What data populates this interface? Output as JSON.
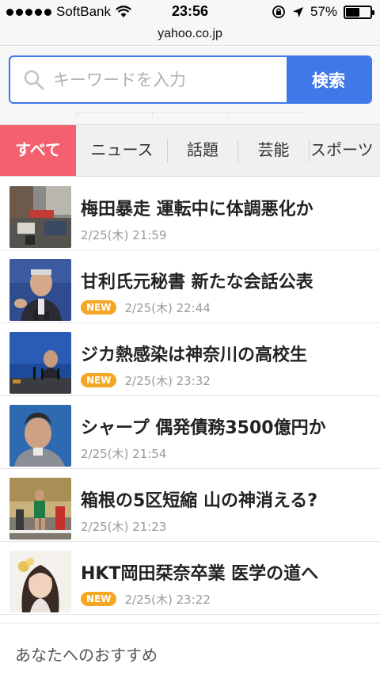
{
  "status_bar": {
    "carrier": "SoftBank",
    "time": "23:56",
    "battery": "57%",
    "battery_level": 0.57
  },
  "browser": {
    "url": "yahoo.co.jp"
  },
  "search": {
    "placeholder": "キーワードを入力",
    "button_label": "検索"
  },
  "tabs": [
    {
      "label": "すべて",
      "active": true
    },
    {
      "label": "ニュース"
    },
    {
      "label": "話題"
    },
    {
      "label": "芸能"
    },
    {
      "label": "スポーツ"
    }
  ],
  "news": [
    {
      "title": "梅田暴走 運転中に体調悪化か",
      "date": "2/25(木) 21:59",
      "is_new": false
    },
    {
      "title": "甘利氏元秘書 新たな会話公表",
      "date": "2/25(木) 22:44",
      "is_new": true
    },
    {
      "title": "ジカ熱感染は神奈川の高校生",
      "date": "2/25(木) 23:32",
      "is_new": true
    },
    {
      "title": "シャープ 偶発債務3500億円か",
      "date": "2/25(木) 21:54",
      "is_new": false
    },
    {
      "title": "箱根の5区短縮 山の神消える?",
      "date": "2/25(木) 21:23",
      "is_new": false
    },
    {
      "title": "HKT岡田栞奈卒業 医学の道へ",
      "date": "2/25(木) 23:22",
      "is_new": true
    }
  ],
  "new_badge": "NEW",
  "recommend_title": "あなたへのおすすめ",
  "colors": {
    "accent_blue": "#3f78e8",
    "tab_active": "#f4616e",
    "new_badge": "#f5a623"
  }
}
